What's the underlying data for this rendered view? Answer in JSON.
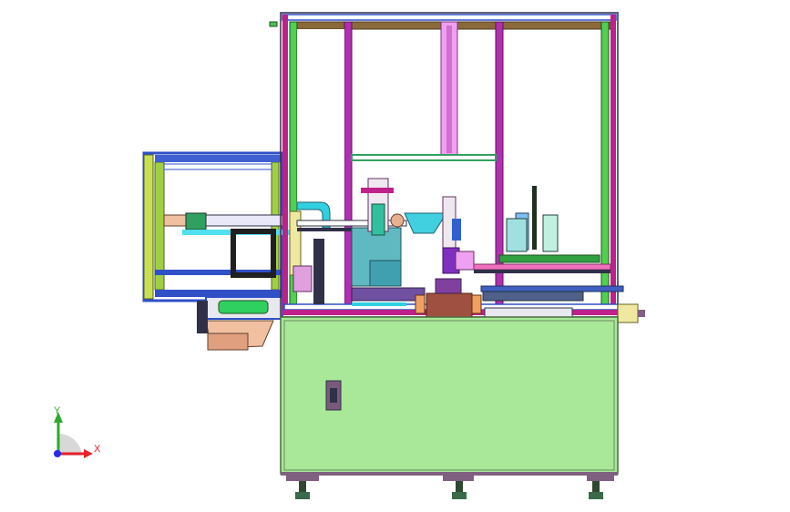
{
  "viewport": {
    "background": "#ffffff"
  },
  "triad": {
    "x_label": "X",
    "y_label": "Y",
    "x_color": "#e8202a",
    "y_color": "#2eaa2e",
    "z_color": "#2a2ae8"
  },
  "colors": {
    "frame_magenta": "#c0208a",
    "frame_blue": "#3050c8",
    "frame_green": "#30c030",
    "cabinet_green": "#a8e898",
    "cabinet_edge": "#4a6a40",
    "top_wood": "#8a6a3a",
    "mast_pink": "#f0a0f0",
    "cyan_part": "#30d0e0",
    "teal_part": "#30a0a0",
    "orange_part": "#e8a070",
    "yellow_part": "#f0e8a0",
    "brown_block": "#a05040",
    "steel_blue": "#5060a0",
    "dark_part": "#303048",
    "foot_purple": "#806080",
    "yellow_green": "#c8e050"
  }
}
